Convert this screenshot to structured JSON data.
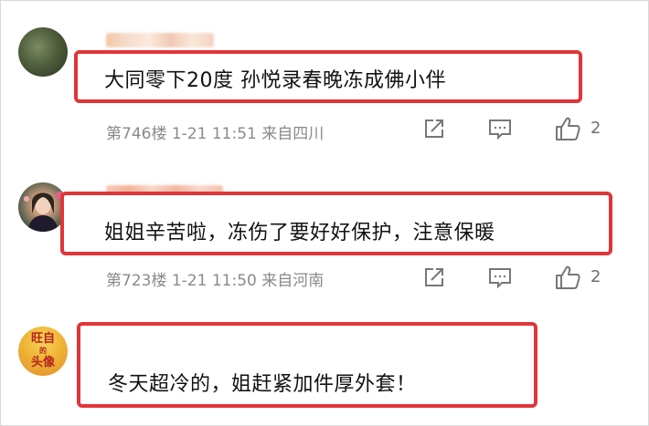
{
  "comments": [
    {
      "text": "大同零下20度 孙悦录春晚冻成佛小伴",
      "meta": "第746楼  1-21 11:51  来自四川",
      "likes": "2"
    },
    {
      "text": "姐姐辛苦啦，冻伤了要好好保护，注意保暖",
      "meta": "第723楼  1-21 11:50  来自河南",
      "likes": "2"
    },
    {
      "text": "冬天超冷的，姐赶紧加件厚外套！",
      "avatar_text": [
        "旺自",
        "的",
        "头像"
      ]
    }
  ],
  "icons": {
    "share": "share-icon",
    "comment": "comment-icon",
    "like": "thumbs-up-icon"
  },
  "colors": {
    "highlight_border": "#e0353a",
    "meta_text": "#8a8a8a"
  }
}
